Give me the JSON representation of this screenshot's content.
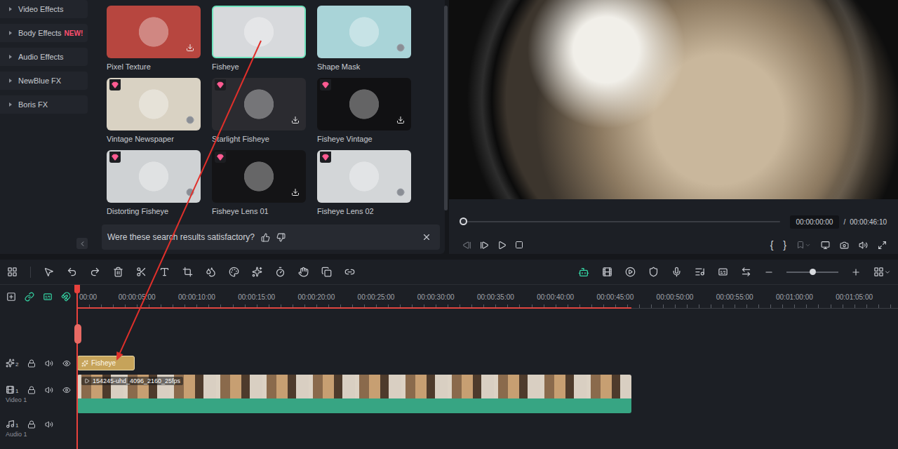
{
  "sidebar": {
    "items": [
      {
        "label": "Video Effects",
        "badge": ""
      },
      {
        "label": "Body Effects",
        "badge": "NEW!"
      },
      {
        "label": "Audio Effects",
        "badge": ""
      },
      {
        "label": "NewBlue FX",
        "badge": ""
      },
      {
        "label": "Boris FX",
        "badge": ""
      }
    ]
  },
  "effects": [
    {
      "name": "Pixel Texture",
      "selected": false,
      "premium": false,
      "status": "download",
      "color": "#b7463f"
    },
    {
      "name": "Fisheye",
      "selected": true,
      "premium": false,
      "status": "none",
      "color": "#d7d9dc"
    },
    {
      "name": "Shape Mask",
      "selected": false,
      "premium": false,
      "status": "ready",
      "color": "#a9d4d8"
    },
    {
      "name": "Vintage Newspaper",
      "selected": false,
      "premium": true,
      "status": "ready",
      "color": "#d9d2c3"
    },
    {
      "name": "Starlight Fisheye",
      "selected": false,
      "premium": true,
      "status": "download",
      "color": "#2b2b30"
    },
    {
      "name": "Fisheye Vintage",
      "selected": false,
      "premium": true,
      "status": "download",
      "color": "#111113"
    },
    {
      "name": "Distorting Fisheye",
      "selected": false,
      "premium": true,
      "status": "ready",
      "color": "#cfd2d4"
    },
    {
      "name": "Fisheye Lens 01",
      "selected": false,
      "premium": true,
      "status": "download",
      "color": "#141416"
    },
    {
      "name": "Fisheye Lens 02",
      "selected": false,
      "premium": true,
      "status": "ready",
      "color": "#d3d6d8"
    }
  ],
  "feedback": {
    "question": "Were these search results satisfactory?"
  },
  "preview": {
    "current": "00:00:00:00",
    "separator": "/",
    "total": "00:00:46:10",
    "level": 0,
    "mark_in": "{",
    "mark_out": "}"
  },
  "timeline": {
    "ruler": [
      "00:00",
      "00:00:05:00",
      "00:00:10:00",
      "00:00:15:00",
      "00:00:20:00",
      "00:00:25:00",
      "00:00:30:00",
      "00:00:35:00",
      "00:00:40:00",
      "00:00:45:00",
      "00:00:50:00",
      "00:00:55:00",
      "00:01:00:00",
      "00:01:05:00"
    ],
    "tracks": [
      {
        "kind": "effect",
        "number": "2",
        "name": "",
        "clips": [
          {
            "label": "Fisheye"
          }
        ]
      },
      {
        "kind": "video",
        "number": "1",
        "name": "Video 1",
        "clips": [
          {
            "label": "154245-uhd_4096_2160_25fps"
          }
        ]
      },
      {
        "kind": "audio",
        "number": "1",
        "name": "Audio 1",
        "clips": []
      }
    ]
  }
}
